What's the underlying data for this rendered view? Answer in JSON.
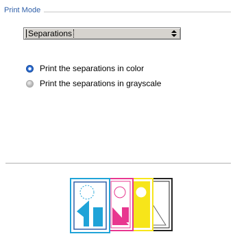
{
  "print_mode": {
    "group_label": "Print Mode",
    "select_value": "Separations",
    "radio_options": [
      {
        "label": "Print the separations in color",
        "selected": true
      },
      {
        "label": "Print the separations in grayscale",
        "selected": false
      }
    ]
  },
  "preview": {
    "plates": [
      "cyan",
      "magenta",
      "yellow",
      "black"
    ],
    "colors": {
      "cyan": "#1fa3d8",
      "magenta": "#e8368f",
      "yellow": "#f7e51a",
      "black": "#222222",
      "accent": "#2f5fa8"
    }
  }
}
